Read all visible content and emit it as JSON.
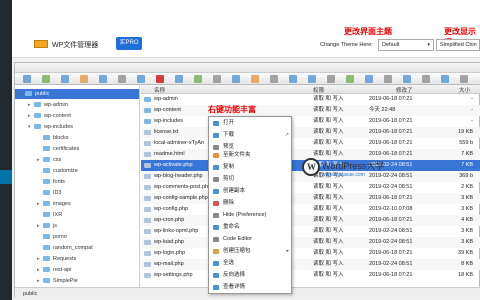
{
  "annotations": {
    "theme": "更改界面主题",
    "display": "更改显示语",
    "context": "右键功能丰富"
  },
  "app": {
    "title": "WP文件管理器",
    "pro_button": "买PRO"
  },
  "theme": {
    "label": "Change Theme Here:",
    "value": "Default"
  },
  "language": {
    "value": "Simplified Chin"
  },
  "tree": [
    {
      "label": "public",
      "level": 0,
      "selected": true,
      "toggle": "▾"
    },
    {
      "label": "wp-admin",
      "level": 1,
      "toggle": "▸"
    },
    {
      "label": "wp-content",
      "level": 1,
      "toggle": "▸"
    },
    {
      "label": "wp-includes",
      "level": 1,
      "toggle": "▾"
    },
    {
      "label": "blocks",
      "level": 2,
      "toggle": ""
    },
    {
      "label": "certificates",
      "level": 2,
      "toggle": ""
    },
    {
      "label": "css",
      "level": 2,
      "toggle": "▸"
    },
    {
      "label": "customize",
      "level": 2,
      "toggle": ""
    },
    {
      "label": "fonts",
      "level": 2,
      "toggle": ""
    },
    {
      "label": "ID3",
      "level": 2,
      "toggle": ""
    },
    {
      "label": "images",
      "level": 2,
      "toggle": "▸"
    },
    {
      "label": "IXR",
      "level": 2,
      "toggle": ""
    },
    {
      "label": "js",
      "level": 2,
      "toggle": "▸"
    },
    {
      "label": "pomo",
      "level": 2,
      "toggle": ""
    },
    {
      "label": "random_compat",
      "level": 2,
      "toggle": ""
    },
    {
      "label": "Requests",
      "level": 2,
      "toggle": "▸"
    },
    {
      "label": "rest-api",
      "level": 2,
      "toggle": "▸"
    },
    {
      "label": "SimplePie",
      "level": 2,
      "toggle": "▸"
    }
  ],
  "columns": {
    "name": "名称",
    "perms": "权限",
    "date": "修改了",
    "size": "大小"
  },
  "files": [
    {
      "name": "wp-admin",
      "perms": "读取 和 写入",
      "date": "2019-06-18 07:21",
      "size": "-",
      "type": "folder"
    },
    {
      "name": "wp-content",
      "perms": "读取 和 写入",
      "date": "今天 22:48",
      "size": "-",
      "type": "folder"
    },
    {
      "name": "wp-includes",
      "perms": "读取 和 写入",
      "date": "2019-06-18 07:21",
      "size": "-",
      "type": "folder"
    },
    {
      "name": "license.txt",
      "perms": "读取 和 写入",
      "date": "2019-06-18 07:21",
      "size": "19 KB",
      "type": "file"
    },
    {
      "name": "local-adminer-xTyAn",
      "perms": "读取 和 写入",
      "date": "2019-06-18 07:21",
      "size": "559 b",
      "type": "file"
    },
    {
      "name": "readme.html",
      "perms": "读取 和 写入",
      "date": "2019-06-18 07:21",
      "size": "7 KB",
      "type": "file"
    },
    {
      "name": "wp-activate.php",
      "perms": "读取 和 写入",
      "date": "2019-02-24 08:51",
      "size": "7 KB",
      "type": "file",
      "selected": true
    },
    {
      "name": "wp-blog-header.php",
      "perms": "读取 和 写入",
      "date": "2019-02-24 08:51",
      "size": "369 b",
      "type": "file"
    },
    {
      "name": "wp-comments-post.php",
      "perms": "读取 和 写入",
      "date": "2019-02-24 08:51",
      "size": "2 KB",
      "type": "file"
    },
    {
      "name": "wp-config-sample.php",
      "perms": "读取 和 写入",
      "date": "2019-06-18 07:21",
      "size": "3 KB",
      "type": "file"
    },
    {
      "name": "wp-config.php",
      "perms": "读取 和 写入",
      "date": "2019-02-10 07:08",
      "size": "3 KB",
      "type": "file"
    },
    {
      "name": "wp-cron.php",
      "perms": "读取 和 写入",
      "date": "2019-06-18 07:21",
      "size": "4 KB",
      "type": "file"
    },
    {
      "name": "wp-links-opml.php",
      "perms": "读取 和 写入",
      "date": "2019-02-24 08:51",
      "size": "3 KB",
      "type": "file"
    },
    {
      "name": "wp-load.php",
      "perms": "读取 和 写入",
      "date": "2019-02-24 08:51",
      "size": "3 KB",
      "type": "file"
    },
    {
      "name": "wp-login.php",
      "perms": "读取 和 写入",
      "date": "2019-06-18 07:21",
      "size": "39 KB",
      "type": "file"
    },
    {
      "name": "wp-mail.php",
      "perms": "读取 和 写入",
      "date": "2019-02-24 08:51",
      "size": "8 KB",
      "type": "file"
    },
    {
      "name": "wp-settings.php",
      "perms": "读取 和 写入",
      "date": "2019-06-18 07:21",
      "size": "18 KB",
      "type": "file"
    }
  ],
  "context_menu": [
    {
      "label": "打开",
      "icon": "open-icon",
      "color": "#4a90d9"
    },
    {
      "label": "下载",
      "icon": "download-icon",
      "color": "#4a90d9",
      "arrow": "↗"
    },
    {
      "label": "预览",
      "icon": "preview-icon",
      "color": "#888888"
    },
    {
      "label": "复制",
      "icon": "copy-icon",
      "color": "#4a90d9"
    },
    {
      "label": "剪切",
      "icon": "cut-icon",
      "color": "#888888"
    },
    {
      "label": "创建副本",
      "icon": "duplicate-icon",
      "color": "#4a90d9"
    },
    {
      "label": "删除",
      "icon": "delete-icon",
      "color": "#d9534f"
    },
    {
      "label": "Hide (Preference)",
      "icon": "hide-icon",
      "color": "#888888"
    },
    {
      "label": "重命名",
      "icon": "rename-icon",
      "color": "#4a90d9"
    },
    {
      "label": "Code Editor",
      "icon": "editor-icon",
      "color": "#888888"
    },
    {
      "label": "创建压缩包",
      "icon": "archive-icon",
      "color": "#d9a34f",
      "arrow": "▸"
    },
    {
      "label": "全选",
      "icon": "select-all-icon",
      "color": "#4a90d9"
    },
    {
      "label": "反向选择",
      "icon": "invert-icon",
      "color": "#4a90d9"
    },
    {
      "label": "查看详情",
      "icon": "info-icon",
      "color": "#4a90d9"
    }
  ],
  "context_menu_header": "至新文件夹",
  "status": {
    "path": "public"
  },
  "watermark": {
    "title": "WordPress大学",
    "url": "www.wpdaxue.com"
  },
  "colors": {
    "accent": "#3875d7",
    "pro": "#1e6fd9",
    "annotation": "#e00000"
  }
}
